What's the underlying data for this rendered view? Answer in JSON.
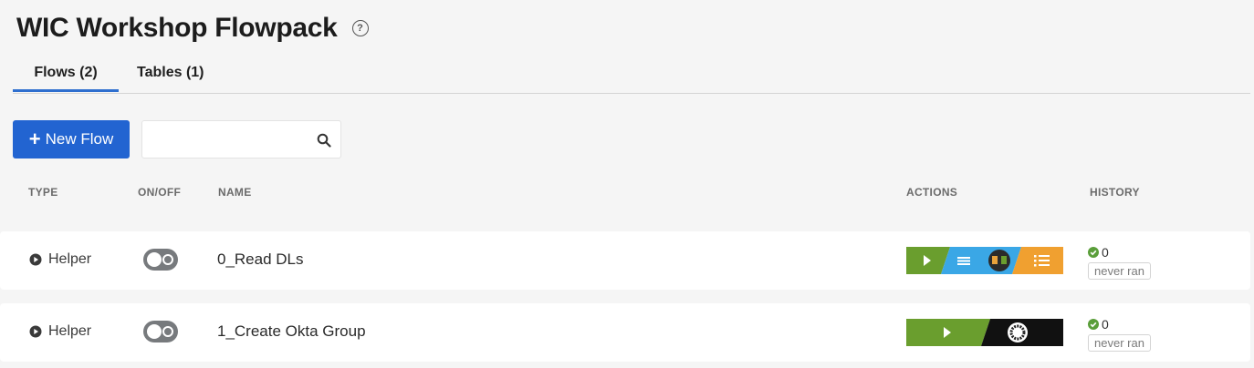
{
  "header": {
    "title": "WIC Workshop Flowpack",
    "help_icon": "?"
  },
  "tabs": [
    {
      "label": "Flows (2)",
      "active": true
    },
    {
      "label": "Tables (1)",
      "active": false
    }
  ],
  "toolbar": {
    "new_flow_label": "New Flow",
    "new_flow_plus": "+",
    "search_value": "",
    "search_placeholder": ""
  },
  "columns": {
    "type": "TYPE",
    "onoff": "ON/OFF",
    "name": "NAME",
    "actions": "ACTIONS",
    "history": "HISTORY"
  },
  "flows": [
    {
      "type": "Helper",
      "enabled": false,
      "name": "0_Read DLs",
      "history_count": "0",
      "history_status": "never ran"
    },
    {
      "type": "Helper",
      "enabled": false,
      "name": "1_Create Okta Group",
      "history_count": "0",
      "history_status": "never ran"
    }
  ],
  "colors": {
    "accent": "#2264d1",
    "play_green": "#6a9e2e",
    "table_blue": "#3aa7e6",
    "list_orange": "#f0a030",
    "success": "#5a9e3a"
  }
}
